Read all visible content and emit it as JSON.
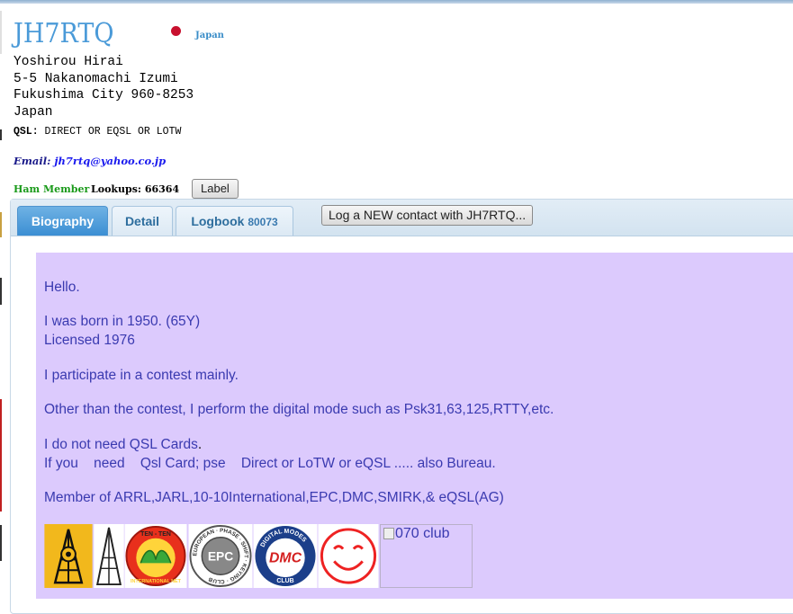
{
  "profile": {
    "callsign": "JH7RTQ",
    "country": "Japan",
    "address": [
      "Yoshirou Hirai",
      "5-5 Nakanomachi Izumi",
      "Fukushima City 960-8253",
      "Japan"
    ],
    "qsl_label": "QSL:",
    "qsl_value": "DIRECT OR EQSL OR LOTW",
    "email_label": "Email:",
    "email_value": "jh7rtq@yahoo.co.jp",
    "member": "Ham Member",
    "lookups_label": "Lookups:",
    "lookups_value": "66364",
    "label_button": "Label"
  },
  "tabs": {
    "biography": "Biography",
    "detail": "Detail",
    "logbook": "Logbook",
    "logbook_count": "80073",
    "log_new_button": "Log a NEW contact with JH7RTQ..."
  },
  "bio": {
    "hello": "Hello.",
    "born": "I was born in 1950. (65Y)",
    "licensed": "Licensed 1976",
    "contest": "I participate in a contest mainly.",
    "digital": "Other than the contest, I perform the digital mode such as Psk31,63,125,RTTY,etc.",
    "qsl1_a": "I do not need QSL Cards",
    "qsl1_b": ".",
    "qsl2": "If you    need    Qsl Card; pse    Direct or LoTW or eQSL ..... also Bureau.",
    "member_of": "Member of ARRL,JARL,10-10International,EPC,DMC,SMIRK,& eQSL(AG)",
    "badges": {
      "tenten_top": "TEN - TEN",
      "tenten_bottom": "INTERNATIONAL NET",
      "epc_ring": "EUROPEAN · PHASE · SHIFT · KEYING · CLUB",
      "epc_center": "EPC",
      "dmc_ring": "DIGITAL MODES",
      "dmc_center": "DMC",
      "dmc_bottom": "CLUB",
      "club_alt": "070 club"
    }
  },
  "colors": {
    "callsign": "#4a9ad8",
    "bio_background": "#dccafd",
    "bio_text": "#3a3ab0",
    "member_green": "#1a9a1a",
    "tab_active": "#3b8ed3",
    "flag_red": "#c8102e"
  }
}
